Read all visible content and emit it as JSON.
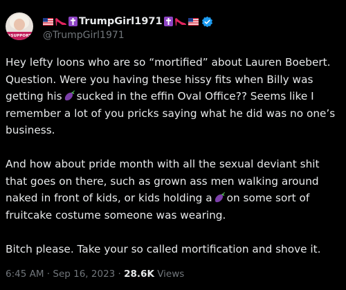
{
  "author": {
    "display_name": "TrumpGirl1971",
    "handle": "@TrumpGirl1971",
    "avatar_badge": "#SUPPORT",
    "verified": true,
    "name_decorations": [
      "flag-us-icon",
      "red-heel-icon",
      "latin-cross-icon"
    ]
  },
  "tweet": {
    "segments": {
      "p1_a": "Hey lefty loons who are so “mortified” about Lauren Boebert. Question. Were you having these hissy fits when Billy was getting his",
      "p1_b": "sucked in the effin Oval Office?? Seems like I remember a lot of you pricks saying what he did was no one’s business.",
      "p2_a": "And how about pride month with all the sexual deviant shit that goes on there, such as grown ass men walking around naked in front of kids, or kids holding a",
      "p2_b": "on some sort of fruitcake costume someone was wearing.",
      "p3": "Bitch please. Take your so called mortification and shove it."
    },
    "emoji": "eggplant-icon"
  },
  "meta": {
    "time": "6:45 AM",
    "separator": "·",
    "date": "Sep 16, 2023",
    "views_count": "28.6K",
    "views_label": "Views"
  },
  "colors": {
    "background": "#000000",
    "text_primary": "#e7e9ea",
    "text_secondary": "#71767b",
    "verified_blue": "#1d9bf0",
    "cross_purple": "#8e44c4",
    "heel_red": "#e0245e"
  }
}
